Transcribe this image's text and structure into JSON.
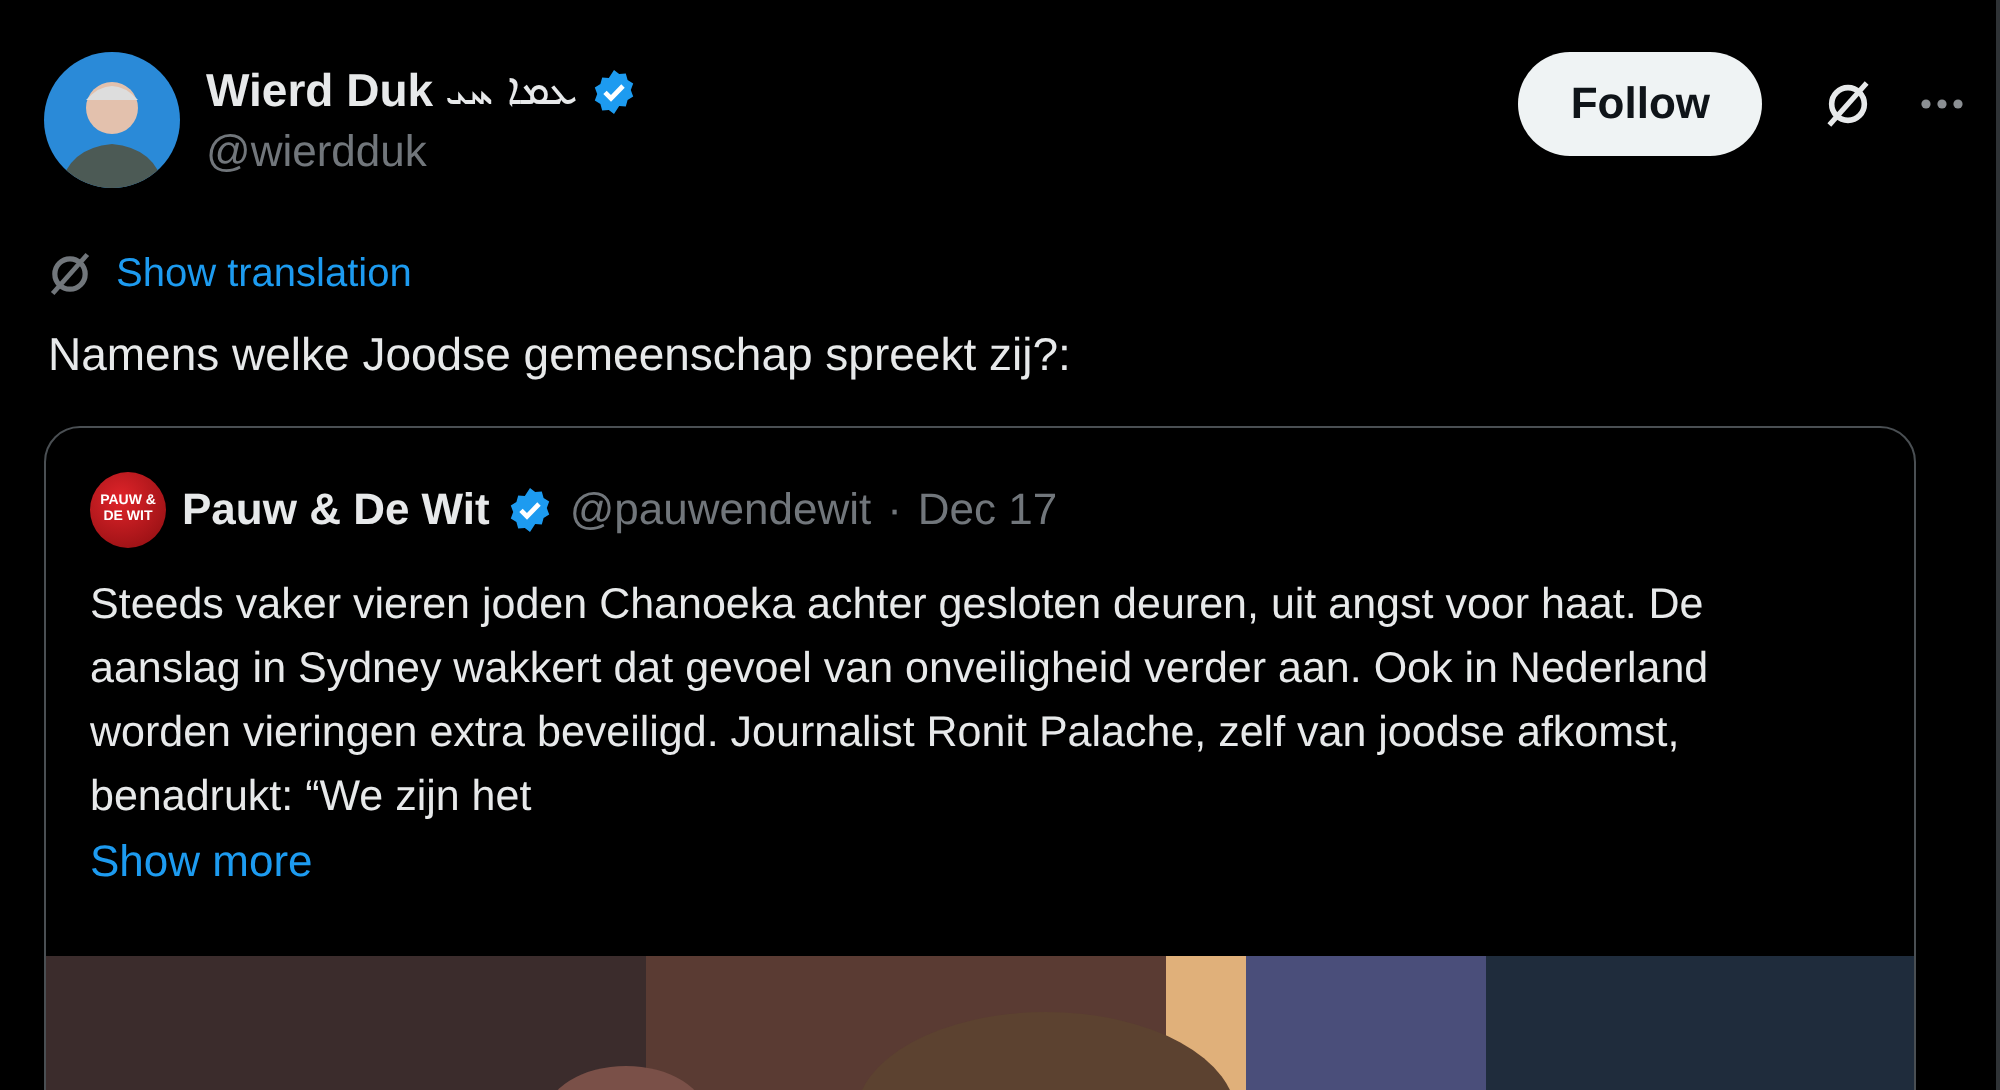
{
  "author": {
    "name": "Wierd Duk",
    "name_extra": "ܥܡܐ ܚܝ",
    "verified": true,
    "handle": "@wierdduk"
  },
  "follow_button": {
    "label": "Follow"
  },
  "translate": {
    "label": "Show translation"
  },
  "text": "Namens welke Joodse gemeenschap spreekt zij?:",
  "quote": {
    "avatar_text": "PAUW & DE WIT",
    "name": "Pauw & De Wit",
    "verified": true,
    "handle": "@pauwendewit",
    "separator": "·",
    "date": "Dec 17",
    "text": "Steeds vaker vieren joden Chanoeka achter gesloten deuren, uit angst voor haat. De aanslag in Sydney wakkert dat gevoel van onveiligheid verder aan. Ook in Nederland worden vieringen extra beveiligd. Journalist Ronit Palache, zelf van joodse afkomst, benadrukt: “We zijn het",
    "more": "Show more"
  }
}
